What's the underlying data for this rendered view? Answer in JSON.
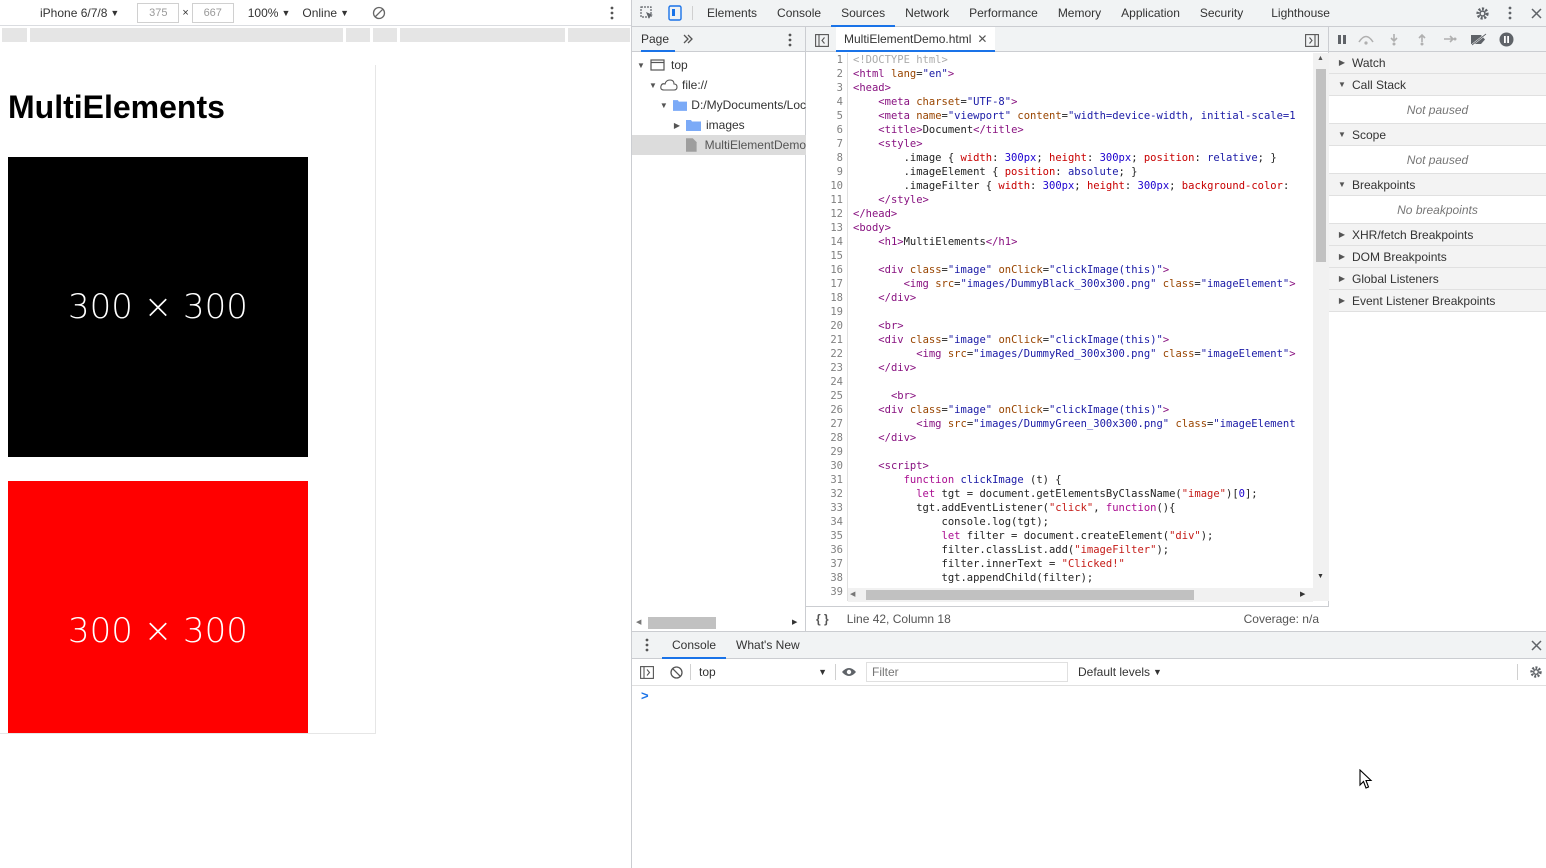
{
  "device_toolbar": {
    "device": "iPhone 6/7/8",
    "width": "375",
    "times": "×",
    "height": "667",
    "zoom": "100%",
    "network": "Online"
  },
  "page": {
    "heading": "MultiElements",
    "images": [
      {
        "label": "300 × 300",
        "color": "#000000"
      },
      {
        "label": "300 × 300",
        "color": "#ff0000"
      }
    ]
  },
  "devtools": {
    "tabs": [
      "Elements",
      "Console",
      "Sources",
      "Network",
      "Performance",
      "Memory",
      "Application",
      "Security",
      "Lighthouse"
    ],
    "active_tab": "Sources"
  },
  "navigator": {
    "tab": "Page",
    "tree": [
      "top",
      "file://",
      "D:/MyDocuments/Loc",
      "images",
      "MultiElementDemo"
    ]
  },
  "editor": {
    "file_tab": "MultiElementDemo.html",
    "status_position": "Line 42, Column 18",
    "coverage": "Coverage: n/a",
    "format_icon": "{ }",
    "line_numbers": [
      "1",
      "2",
      "3",
      "4",
      "5",
      "6",
      "7",
      "8",
      "9",
      "10",
      "11",
      "12",
      "13",
      "14",
      "15",
      "16",
      "17",
      "18",
      "19",
      "20",
      "21",
      "22",
      "23",
      "24",
      "25",
      "26",
      "27",
      "28",
      "29",
      "30",
      "31",
      "32",
      "33",
      "34",
      "35",
      "36",
      "37",
      "38",
      "39"
    ]
  },
  "debugger": {
    "watch": "Watch",
    "call_stack": "Call Stack",
    "call_stack_status": "Not paused",
    "scope": "Scope",
    "scope_status": "Not paused",
    "breakpoints": "Breakpoints",
    "breakpoints_status": "No breakpoints",
    "xhr": "XHR/fetch Breakpoints",
    "dom": "DOM Breakpoints",
    "global": "Global Listeners",
    "event": "Event Listener Breakpoints"
  },
  "drawer": {
    "tabs": [
      "Console",
      "What's New"
    ],
    "context": "top",
    "filter_placeholder": "Filter",
    "levels": "Default levels",
    "prompt": ">"
  }
}
